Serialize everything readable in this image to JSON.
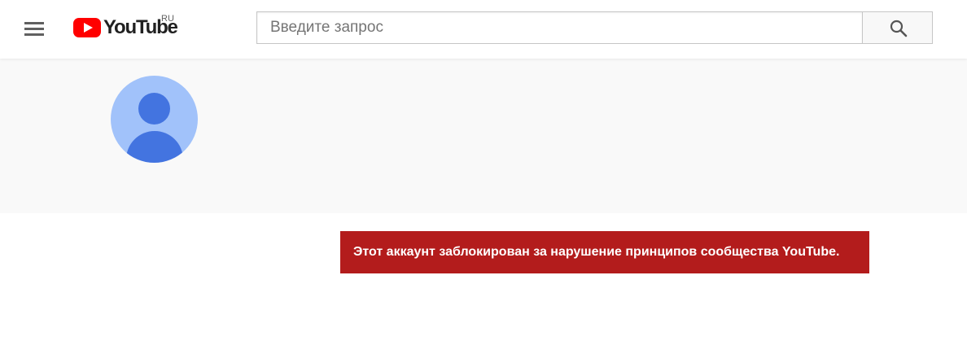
{
  "header": {
    "menu_icon": "hamburger-menu-icon",
    "logo": {
      "wordmark": "YouTube",
      "region": "RU",
      "icon": "play-button-logo-icon",
      "brand_color": "#ff0000"
    },
    "search": {
      "placeholder": "Введите запрос",
      "value": "",
      "button_icon": "search-icon"
    }
  },
  "channel": {
    "avatar_icon": "default-user-avatar-icon",
    "avatar_colors": {
      "background": "#a1c2fa",
      "figure": "#4374e0"
    }
  },
  "alert": {
    "message": "Этот аккаунт заблокирован за нарушение принципов сообщества YouTube.",
    "color": "#b31c1c"
  }
}
